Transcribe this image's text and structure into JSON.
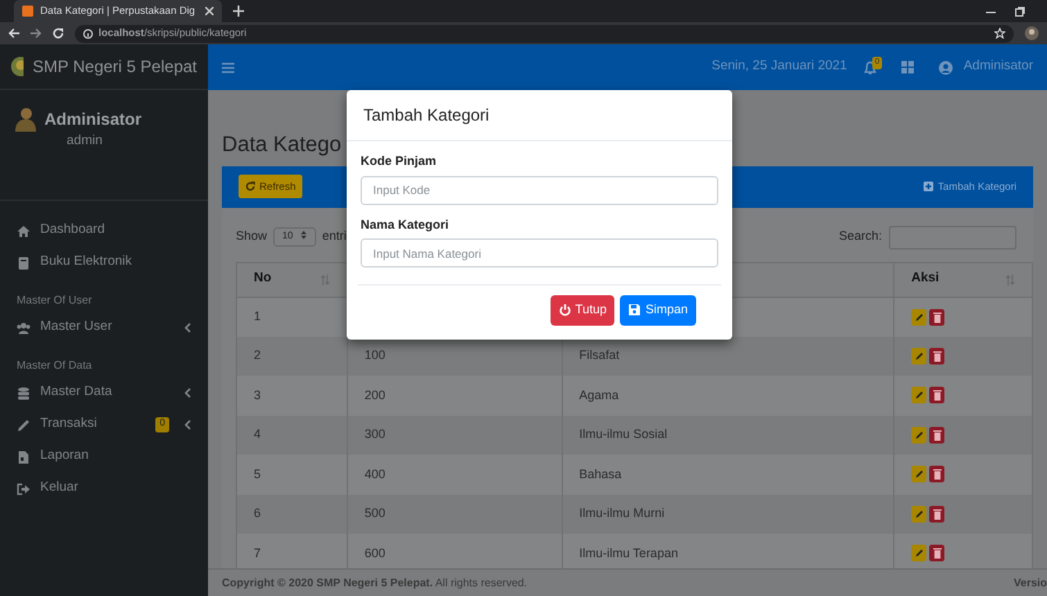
{
  "browser": {
    "tab_title": "Data Kategori | Perpustakaan Dig",
    "address": "**localhost**/skripsi/public/kategori"
  },
  "sidebar": {
    "brand": "SMP Negeri 5 Pelepat",
    "user_name": "Adminisator",
    "user_role": "admin",
    "items": [
      {
        "kind": "link",
        "label": "Dashboard"
      },
      {
        "kind": "link",
        "label": "Buku Elektronik"
      },
      {
        "kind": "header",
        "label": "Master Of User"
      },
      {
        "kind": "link",
        "label": "Master User",
        "expandable": true
      },
      {
        "kind": "header",
        "label": "Master Of Data"
      },
      {
        "kind": "link",
        "label": "Master Data",
        "expandable": true
      },
      {
        "kind": "link",
        "label": "Transaksi",
        "badge": "0",
        "expandable": true
      },
      {
        "kind": "link",
        "label": "Laporan"
      },
      {
        "kind": "link",
        "label": "Keluar"
      }
    ]
  },
  "navbar": {
    "date": "Senin, 25 Januari 2021",
    "notification_count": "0",
    "user": "Adminisator"
  },
  "page": {
    "title": "Data Katego"
  },
  "card": {
    "refresh": "Refresh",
    "add": "Tambah Kategori",
    "show_label": "Show",
    "page_size": "10",
    "entries_label": "entri",
    "search_label": "Search:"
  },
  "table": {
    "header": {
      "column_1": "No",
      "column_4": "Aksi"
    },
    "rows": [
      {
        "no": "1"
      },
      {
        "no": "2",
        "code": "100",
        "name": "Filsafat"
      },
      {
        "no": "3",
        "code": "200",
        "name": "Agama"
      },
      {
        "no": "4",
        "code": "300",
        "name": "Ilmu-ilmu Sosial"
      },
      {
        "no": "5",
        "code": "400",
        "name": "Bahasa"
      },
      {
        "no": "6",
        "code": "500",
        "name": "Ilmu-ilmu Murni"
      },
      {
        "no": "7",
        "code": "600",
        "name": "Ilmu-ilmu Terapan"
      }
    ]
  },
  "footer": {
    "copyright": "Copyright © 2020",
    "link": "SMP Negeri 5 Pelepat.",
    "rights": "All rights reserved.",
    "version": "Versio"
  },
  "modal": {
    "title": "Tambah Kategori",
    "fields": [
      {
        "label": "Kode Pinjam",
        "placeholder": "Input Kode"
      },
      {
        "label": "Nama Kategori",
        "placeholder": "Input Nama Kategori"
      }
    ],
    "buttons": [
      {
        "kind": "close",
        "label": "Tutup"
      },
      {
        "kind": "save",
        "label": "Simpan"
      }
    ]
  }
}
